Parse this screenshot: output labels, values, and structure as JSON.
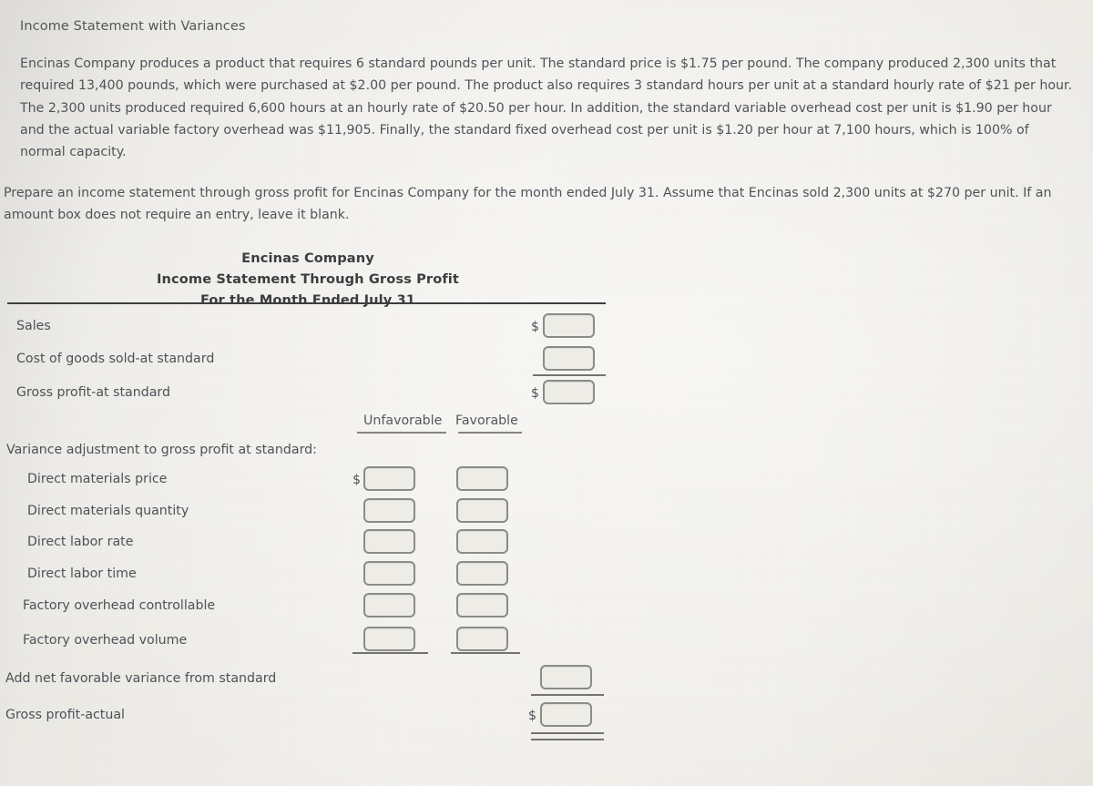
{
  "question": {
    "title": "Income Statement with Variances",
    "problem_text": "Encinas Company produces a product that requires 6 standard pounds per unit. The standard price is $1.75 per pound. The company produced 2,300 units that required 13,400 pounds, which were purchased at $2.00 per pound. The product also requires 3 standard hours per unit at a standard hourly rate of $21 per hour. The 2,300 units produced required 6,600 hours at an hourly rate of $20.50 per hour. In addition, the standard variable overhead cost per unit is $1.90 per hour and the actual variable factory overhead was $11,905. Finally, the standard fixed overhead cost per unit is $1.20 per hour at 7,100 hours, which is 100% of normal capacity.",
    "instructions": "Prepare an income statement through gross profit for Encinas Company for the month ended July 31. Assume that Encinas sold 2,300 units at $270 per unit. If an amount box does not require an entry, leave it blank."
  },
  "statement": {
    "company": "Encinas Company",
    "title": "Income Statement Through Gross Profit",
    "period": "For the Month Ended July 31"
  },
  "currency_symbol": "$",
  "column_headers": {
    "unfavorable": "Unfavorable",
    "favorable": "Favorable"
  },
  "rows": {
    "sales": "Sales",
    "cogs_standard": "Cost of goods sold-at standard",
    "gross_profit_standard": "Gross profit-at standard",
    "variance_section": "Variance adjustment to gross profit at standard:",
    "dm_price": "Direct materials price",
    "dm_quantity": "Direct materials quantity",
    "dl_rate": "Direct labor rate",
    "dl_time": "Direct labor time",
    "foh_controllable": "Factory overhead controllable",
    "foh_volume": "Factory overhead volume",
    "add_net_favorable": "Add net favorable variance from standard",
    "gross_profit_actual": "Gross profit-actual"
  },
  "inputs": {
    "sales_amount": "",
    "cogs_amount": "",
    "gross_profit_standard_amount": "",
    "dm_price_unfav": "",
    "dm_price_fav": "",
    "dm_quantity_unfav": "",
    "dm_quantity_fav": "",
    "dl_rate_unfav": "",
    "dl_rate_fav": "",
    "dl_time_unfav": "",
    "dl_time_fav": "",
    "foh_controllable_unfav": "",
    "foh_controllable_fav": "",
    "foh_volume_unfav": "",
    "foh_volume_fav": "",
    "net_favorable_amount": "",
    "gross_profit_actual_amount": ""
  },
  "colors": {
    "background": "#efede8",
    "text": "#50525a",
    "rule": "#3e3e40",
    "box_border": "#8b8b88"
  }
}
